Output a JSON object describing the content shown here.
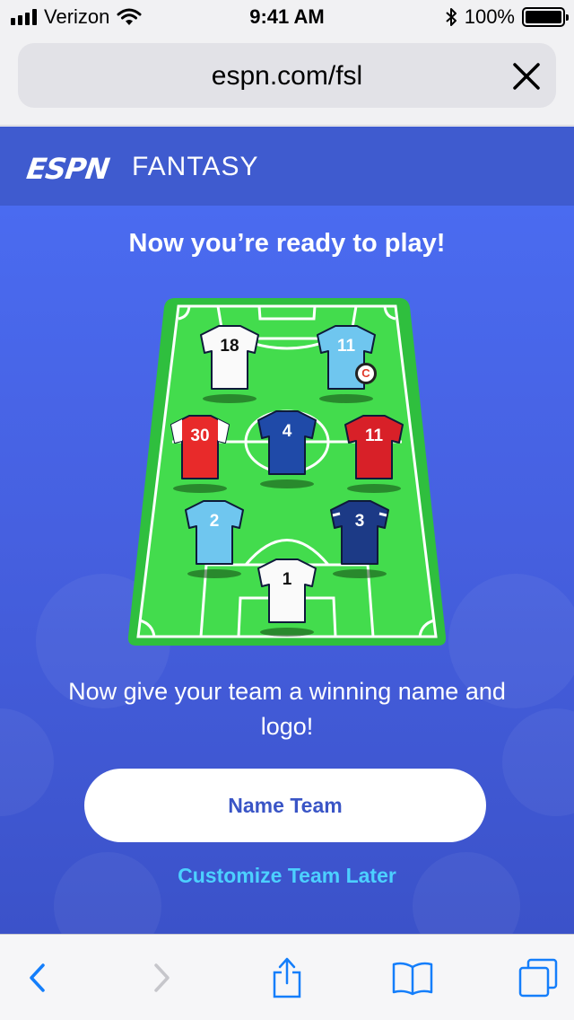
{
  "status_bar": {
    "carrier": "Verizon",
    "time": "9:41 AM",
    "battery": "100%"
  },
  "browser": {
    "url": "espn.com/fsl"
  },
  "header": {
    "logo": "ESPN",
    "section": "FANTASY"
  },
  "main": {
    "headline": "Now you’re ready to play!",
    "subtext": "Now give your team a winning name and logo!",
    "name_team_label": "Name Team",
    "customize_later_label": "Customize Team Later"
  },
  "lineup": [
    {
      "number": "18",
      "kit": "white",
      "captain": false
    },
    {
      "number": "11",
      "kit": "sky-blue",
      "captain": true,
      "captain_label": "C"
    },
    {
      "number": "30",
      "kit": "red-white-sleeves",
      "captain": false
    },
    {
      "number": "4",
      "kit": "royal-blue",
      "captain": false
    },
    {
      "number": "11",
      "kit": "red",
      "captain": false
    },
    {
      "number": "2",
      "kit": "sky-blue",
      "captain": false
    },
    {
      "number": "3",
      "kit": "navy",
      "captain": false
    },
    {
      "number": "1",
      "kit": "white",
      "captain": false
    }
  ],
  "colors": {
    "header": "#3f5bcf",
    "main_top": "#4a6bf0",
    "pitch": "#3bd44a",
    "link": "#4cd0ff",
    "ios_blue": "#147efb"
  },
  "icons": {
    "close": "close-icon",
    "back": "chevron-left-icon",
    "forward": "chevron-right-icon",
    "share": "share-icon",
    "bookmarks": "book-icon",
    "tabs": "tabs-icon"
  }
}
